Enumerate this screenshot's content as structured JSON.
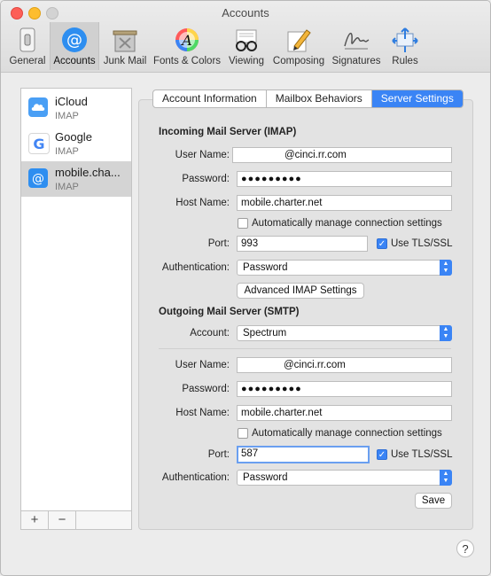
{
  "window": {
    "title": "Accounts"
  },
  "toolbar": {
    "items": [
      {
        "label": "General",
        "icon": "general-switch-icon"
      },
      {
        "label": "Accounts",
        "icon": "at-sign-icon"
      },
      {
        "label": "Junk Mail",
        "icon": "junk-mail-icon"
      },
      {
        "label": "Fonts & Colors",
        "icon": "fonts-colors-icon"
      },
      {
        "label": "Viewing",
        "icon": "glasses-icon"
      },
      {
        "label": "Composing",
        "icon": "pencil-icon"
      },
      {
        "label": "Signatures",
        "icon": "signature-icon"
      },
      {
        "label": "Rules",
        "icon": "rules-icon"
      }
    ],
    "active": "Accounts"
  },
  "sidebar": {
    "accounts": [
      {
        "name": "iCloud",
        "type": "IMAP",
        "icon": "icloud-icon"
      },
      {
        "name": "Google",
        "type": "IMAP",
        "icon": "google-icon"
      },
      {
        "name": "mobile.cha...",
        "type": "IMAP",
        "icon": "at-sign-icon"
      }
    ],
    "add_label": "+",
    "remove_label": "−"
  },
  "tabs": {
    "account_information": "Account Information",
    "mailbox_behaviors": "Mailbox Behaviors",
    "server_settings": "Server Settings",
    "active": "Server Settings"
  },
  "incoming": {
    "heading": "Incoming Mail Server (IMAP)",
    "user_name_label": "User Name:",
    "user_name_value": "@cinci.rr.com",
    "password_label": "Password:",
    "password_value": "●●●●●●●●●",
    "host_name_label": "Host Name:",
    "host_name_value": "mobile.charter.net",
    "auto_manage_label": "Automatically manage connection settings",
    "auto_manage_checked": false,
    "port_label": "Port:",
    "port_value": "993",
    "tls_label": "Use TLS/SSL",
    "tls_checked": true,
    "auth_label": "Authentication:",
    "auth_value": "Password",
    "advanced_button": "Advanced IMAP Settings"
  },
  "outgoing": {
    "heading": "Outgoing Mail Server (SMTP)",
    "account_label": "Account:",
    "account_value": "Spectrum",
    "user_name_label": "User Name:",
    "user_name_value": "@cinci.rr.com",
    "password_label": "Password:",
    "password_value": "●●●●●●●●●",
    "host_name_label": "Host Name:",
    "host_name_value": "mobile.charter.net",
    "auto_manage_label": "Automatically manage connection settings",
    "auto_manage_checked": false,
    "port_label": "Port:",
    "port_value": "587",
    "tls_label": "Use TLS/SSL",
    "tls_checked": true,
    "auth_label": "Authentication:",
    "auth_value": "Password"
  },
  "save_button": "Save",
  "help_button": "?",
  "colors": {
    "accent": "#3a84f5",
    "selection": "#d4d4d4"
  }
}
